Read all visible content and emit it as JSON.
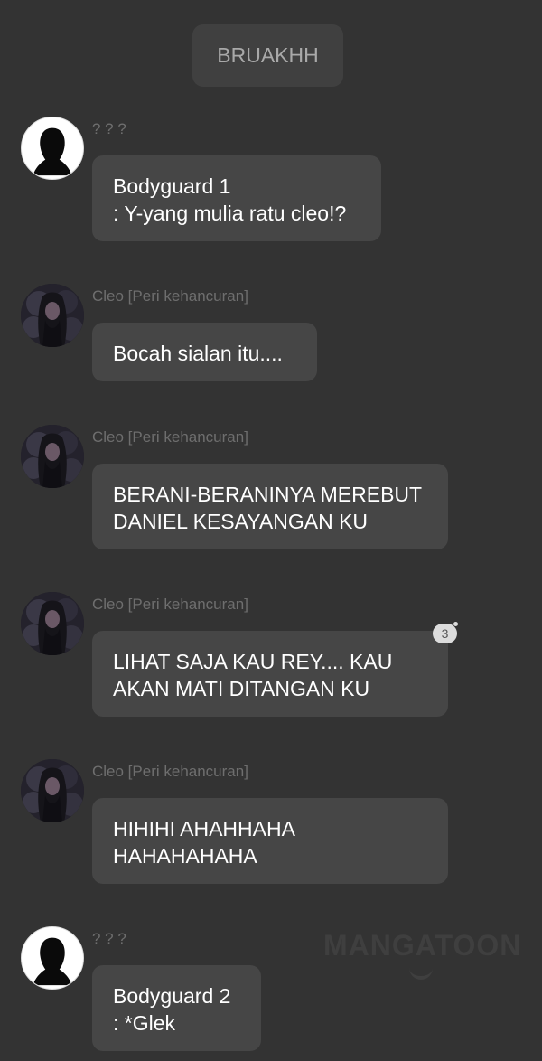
{
  "system_message": "BRUAKHH",
  "messages": [
    {
      "sender": "? ? ?",
      "avatar": "silhouette-icon",
      "lines": [
        "Bodyguard 1",
        ": Y-yang mulia ratu cleo!?"
      ]
    },
    {
      "sender": "Cleo [Peri kehancuran]",
      "avatar": "cleo-avatar",
      "lines": [
        "Bocah sialan itu...."
      ]
    },
    {
      "sender": "Cleo [Peri kehancuran]",
      "avatar": "cleo-avatar",
      "lines": [
        "BERANI-BERANINYA MEREBUT",
        "DANIEL KESAYANGAN KU"
      ]
    },
    {
      "sender": "Cleo [Peri kehancuran]",
      "avatar": "cleo-avatar",
      "lines": [
        "LIHAT SAJA KAU REY.... KAU",
        "AKAN MATI DITANGAN KU"
      ],
      "comment_count": "3"
    },
    {
      "sender": "Cleo [Peri kehancuran]",
      "avatar": "cleo-avatar",
      "lines": [
        "HIHIHI AHAHHAHA",
        "HAHAHAHAHA"
      ]
    },
    {
      "sender": "? ? ?",
      "avatar": "silhouette-icon",
      "lines": [
        "Bodyguard 2",
        ": *Glek"
      ]
    }
  ],
  "watermark": "MANGATOON",
  "colors": {
    "background": "#333333",
    "bubble": "#464646",
    "system_bubble": "#404040",
    "sender_name": "#6e6e6e",
    "message_text": "#ffffff"
  }
}
